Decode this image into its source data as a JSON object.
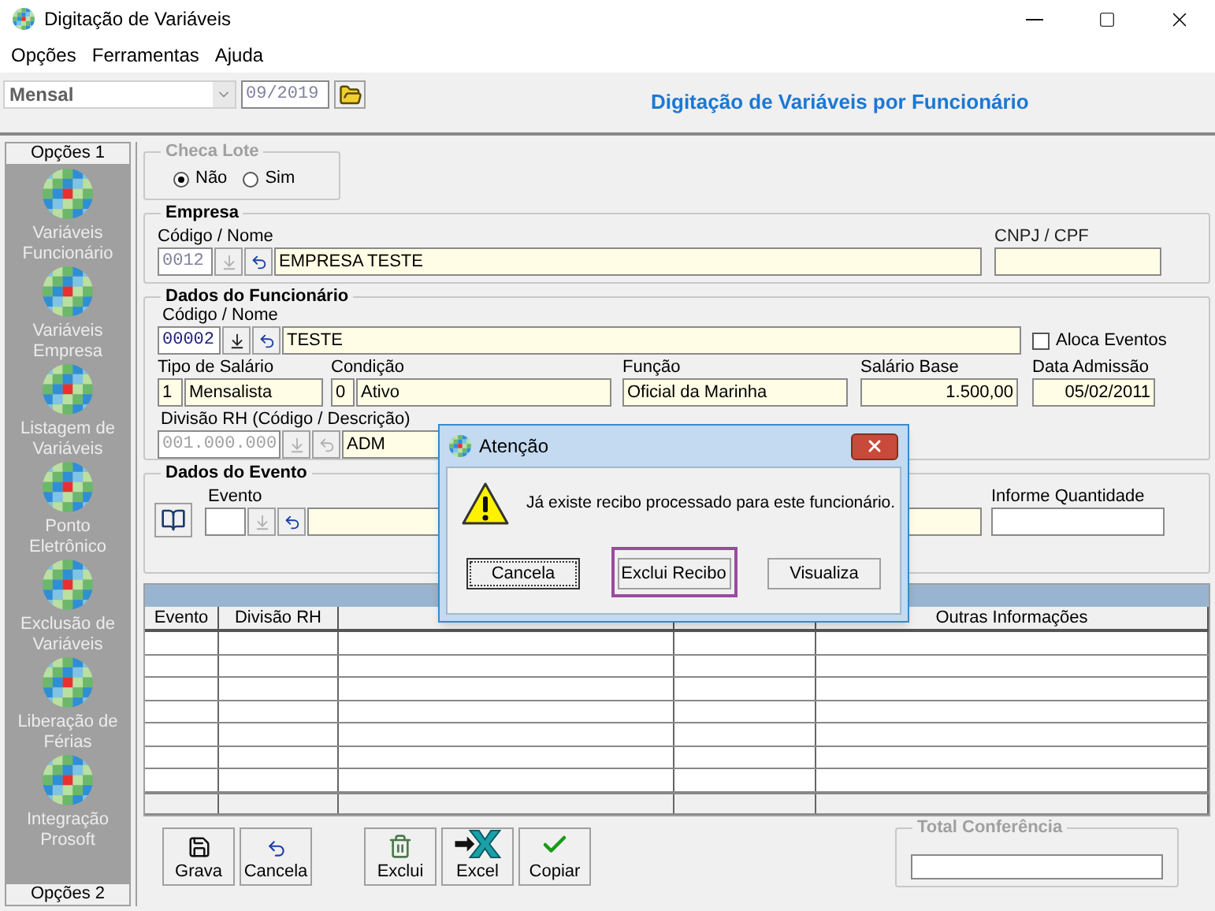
{
  "window": {
    "title": "Digitação de Variáveis"
  },
  "menu": [
    "Opções",
    "Ferramentas",
    "Ajuda"
  ],
  "toolbar": {
    "period": "Mensal",
    "date": "09/2019",
    "heading": "Digitação de Variáveis por Funcionário"
  },
  "sidebar": {
    "top_tab": "Opções 1",
    "bottom_tab": "Opções 2",
    "items": [
      {
        "label": "Variáveis Funcionário"
      },
      {
        "label": "Variáveis Empresa"
      },
      {
        "label": "Listagem de Variáveis"
      },
      {
        "label": "Ponto Eletrônico"
      },
      {
        "label": "Exclusão de Variáveis"
      },
      {
        "label": "Liberação de Férias"
      },
      {
        "label": "Integração Prosoft"
      }
    ]
  },
  "checa_lote": {
    "title": "Checa Lote",
    "options": [
      {
        "label": "Não",
        "selected": true
      },
      {
        "label": "Sim",
        "selected": false
      }
    ]
  },
  "empresa": {
    "title": "Empresa",
    "code_label": "Código / Nome",
    "code": "0012",
    "name": "EMPRESA TESTE",
    "cnpj_label": "CNPJ / CPF"
  },
  "funcionario": {
    "title": "Dados do Funcionário",
    "code_label": "Código / Nome",
    "code": "00002",
    "name": "TESTE",
    "aloca": {
      "label": "Aloca Eventos",
      "checked": false
    },
    "tipo": {
      "label": "Tipo de Salário",
      "code": "1",
      "value": "Mensalista"
    },
    "condicao": {
      "label": "Condição",
      "code": "0",
      "value": "Ativo"
    },
    "funcao": {
      "label": "Função",
      "value": "Oficial da Marinha"
    },
    "salario": {
      "label": "Salário Base",
      "value": "1.500,00"
    },
    "admissao": {
      "label": "Data Admissão",
      "value": "05/02/2011"
    },
    "divisao": {
      "label": "Divisão RH (Código / Descrição)",
      "code": "001.000.000",
      "name": "ADM"
    }
  },
  "evento": {
    "title": "Dados do Evento",
    "evento_label": "Evento",
    "quantidade_label": "Informe Quantidade"
  },
  "table": {
    "columns": [
      "Evento",
      "Divisão RH",
      "Outras Informações"
    ]
  },
  "buttons": [
    {
      "kind": "save",
      "label": "Grava"
    },
    {
      "kind": "undo",
      "label": "Cancela"
    },
    {
      "kind": "trash",
      "label": "Exclui"
    },
    {
      "kind": "excel",
      "label": "Excel"
    },
    {
      "kind": "check",
      "label": "Copiar"
    }
  ],
  "total": {
    "title": "Total Conferência"
  },
  "dialog": {
    "title": "Atenção",
    "message": "Já existe recibo processado para este funcionário.",
    "buttons": [
      {
        "label": "Cancela",
        "focused": true,
        "highlighted": false
      },
      {
        "label": "Exclui Recibo",
        "focused": false,
        "highlighted": true
      },
      {
        "label": "Visualiza",
        "focused": false,
        "highlighted": false
      }
    ]
  }
}
